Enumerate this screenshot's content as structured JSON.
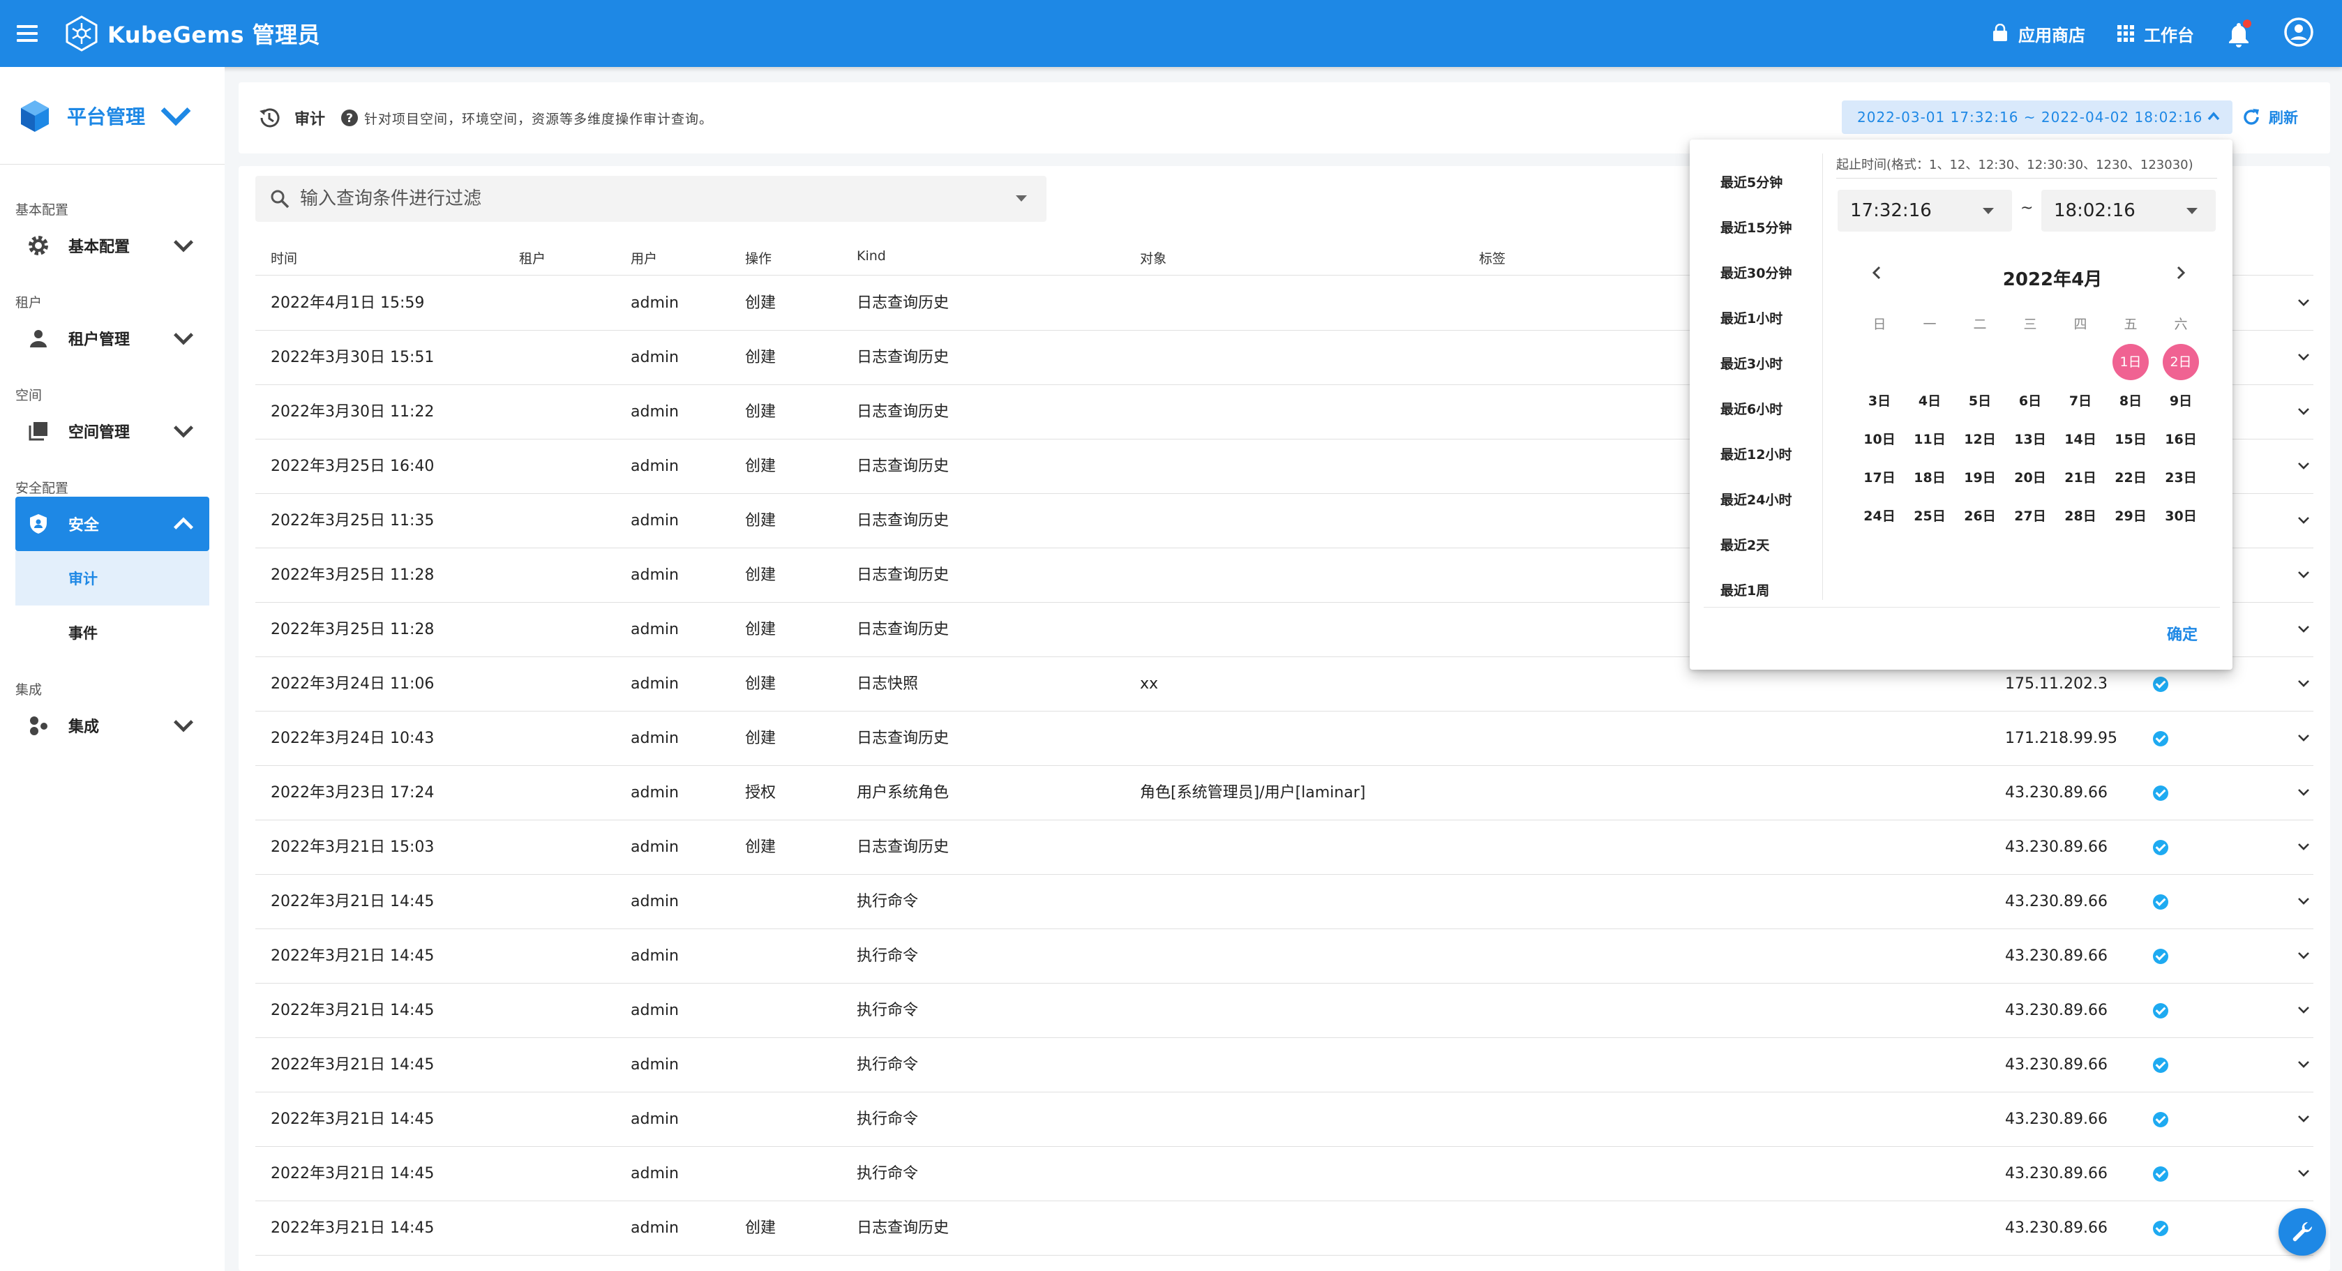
{
  "app": {
    "brand": "KubeGems 管理员"
  },
  "topbar": {
    "appstore": "应用商店",
    "workbench": "工作台"
  },
  "sidebar": {
    "platform": "平台管理",
    "groups": [
      {
        "title": "基本配置",
        "item": "基本配置"
      },
      {
        "title": "租户",
        "item": "租户管理"
      },
      {
        "title": "空间",
        "item": "空间管理"
      },
      {
        "title": "安全配置",
        "item": "安全",
        "subs": [
          "审计",
          "事件"
        ]
      },
      {
        "title": "集成",
        "item": "集成"
      }
    ]
  },
  "header": {
    "title": "审计",
    "desc": "针对项目空间，环境空间，资源等多维度操作审计查询。",
    "range": "2022-03-01 17:32:16 ~ 2022-04-02 18:02:16",
    "refresh": "刷新"
  },
  "filter": {
    "placeholder": "输入查询条件进行过滤"
  },
  "table": {
    "headers": [
      "时间",
      "租户",
      "用户",
      "操作",
      "Kind",
      "对象",
      "标签"
    ],
    "rows": [
      {
        "time": "2022年4月1日 15:59",
        "user": "admin",
        "op": "创建",
        "kind": "日志查询历史",
        "obj": "",
        "ip": ""
      },
      {
        "time": "2022年3月30日 15:51",
        "user": "admin",
        "op": "创建",
        "kind": "日志查询历史",
        "obj": "",
        "ip": ""
      },
      {
        "time": "2022年3月30日 11:22",
        "user": "admin",
        "op": "创建",
        "kind": "日志查询历史",
        "obj": "",
        "ip": ""
      },
      {
        "time": "2022年3月25日 16:40",
        "user": "admin",
        "op": "创建",
        "kind": "日志查询历史",
        "obj": "",
        "ip": ""
      },
      {
        "time": "2022年3月25日 11:35",
        "user": "admin",
        "op": "创建",
        "kind": "日志查询历史",
        "obj": "",
        "ip": ""
      },
      {
        "time": "2022年3月25日 11:28",
        "user": "admin",
        "op": "创建",
        "kind": "日志查询历史",
        "obj": "",
        "ip": ""
      },
      {
        "time": "2022年3月25日 11:28",
        "user": "admin",
        "op": "创建",
        "kind": "日志查询历史",
        "obj": "",
        "ip": ""
      },
      {
        "time": "2022年3月24日 11:06",
        "user": "admin",
        "op": "创建",
        "kind": "日志快照",
        "obj": "xx",
        "ip": "175.11.202.3"
      },
      {
        "time": "2022年3月24日 10:43",
        "user": "admin",
        "op": "创建",
        "kind": "日志查询历史",
        "obj": "",
        "ip": "171.218.99.95"
      },
      {
        "time": "2022年3月23日 17:24",
        "user": "admin",
        "op": "授权",
        "kind": "用户系统角色",
        "obj": "角色[系统管理员]/用户[laminar]",
        "ip": "43.230.89.66"
      },
      {
        "time": "2022年3月21日 15:03",
        "user": "admin",
        "op": "创建",
        "kind": "日志查询历史",
        "obj": "",
        "ip": "43.230.89.66"
      },
      {
        "time": "2022年3月21日 14:45",
        "user": "admin",
        "op": "",
        "kind": "执行命令",
        "obj": "",
        "ip": "43.230.89.66"
      },
      {
        "time": "2022年3月21日 14:45",
        "user": "admin",
        "op": "",
        "kind": "执行命令",
        "obj": "",
        "ip": "43.230.89.66"
      },
      {
        "time": "2022年3月21日 14:45",
        "user": "admin",
        "op": "",
        "kind": "执行命令",
        "obj": "",
        "ip": "43.230.89.66"
      },
      {
        "time": "2022年3月21日 14:45",
        "user": "admin",
        "op": "",
        "kind": "执行命令",
        "obj": "",
        "ip": "43.230.89.66"
      },
      {
        "time": "2022年3月21日 14:45",
        "user": "admin",
        "op": "",
        "kind": "执行命令",
        "obj": "",
        "ip": "43.230.89.66"
      },
      {
        "time": "2022年3月21日 14:45",
        "user": "admin",
        "op": "",
        "kind": "执行命令",
        "obj": "",
        "ip": "43.230.89.66"
      },
      {
        "time": "2022年3月21日 14:45",
        "user": "admin",
        "op": "创建",
        "kind": "日志查询历史",
        "obj": "",
        "ip": "43.230.89.66"
      }
    ]
  },
  "picker": {
    "quick": [
      "最近5分钟",
      "最近15分钟",
      "最近30分钟",
      "最近1小时",
      "最近3小时",
      "最近6小时",
      "最近12小时",
      "最近24小时",
      "最近2天",
      "最近1周"
    ],
    "hint": "起止时间(格式：1、12、12:30、12:30:30、1230、123030)",
    "start_time": "17:32:16",
    "end_time": "18:02:16",
    "tilde": "~",
    "month": "2022年4月",
    "weekdays": [
      "日",
      "一",
      "二",
      "三",
      "四",
      "五",
      "六"
    ],
    "weeks": [
      [
        "",
        "",
        "",
        "",
        "",
        "1日",
        "2日"
      ],
      [
        "3日",
        "4日",
        "5日",
        "6日",
        "7日",
        "8日",
        "9日"
      ],
      [
        "10日",
        "11日",
        "12日",
        "13日",
        "14日",
        "15日",
        "16日"
      ],
      [
        "17日",
        "18日",
        "19日",
        "20日",
        "21日",
        "22日",
        "23日"
      ],
      [
        "24日",
        "25日",
        "26日",
        "27日",
        "28日",
        "29日",
        "30日"
      ]
    ],
    "selected": [
      "1日",
      "2日"
    ],
    "confirm": "确定"
  },
  "colors": {
    "primary": "#1e88e5",
    "selected_day": "#f06292",
    "status_ok": "#1eaaf1"
  }
}
